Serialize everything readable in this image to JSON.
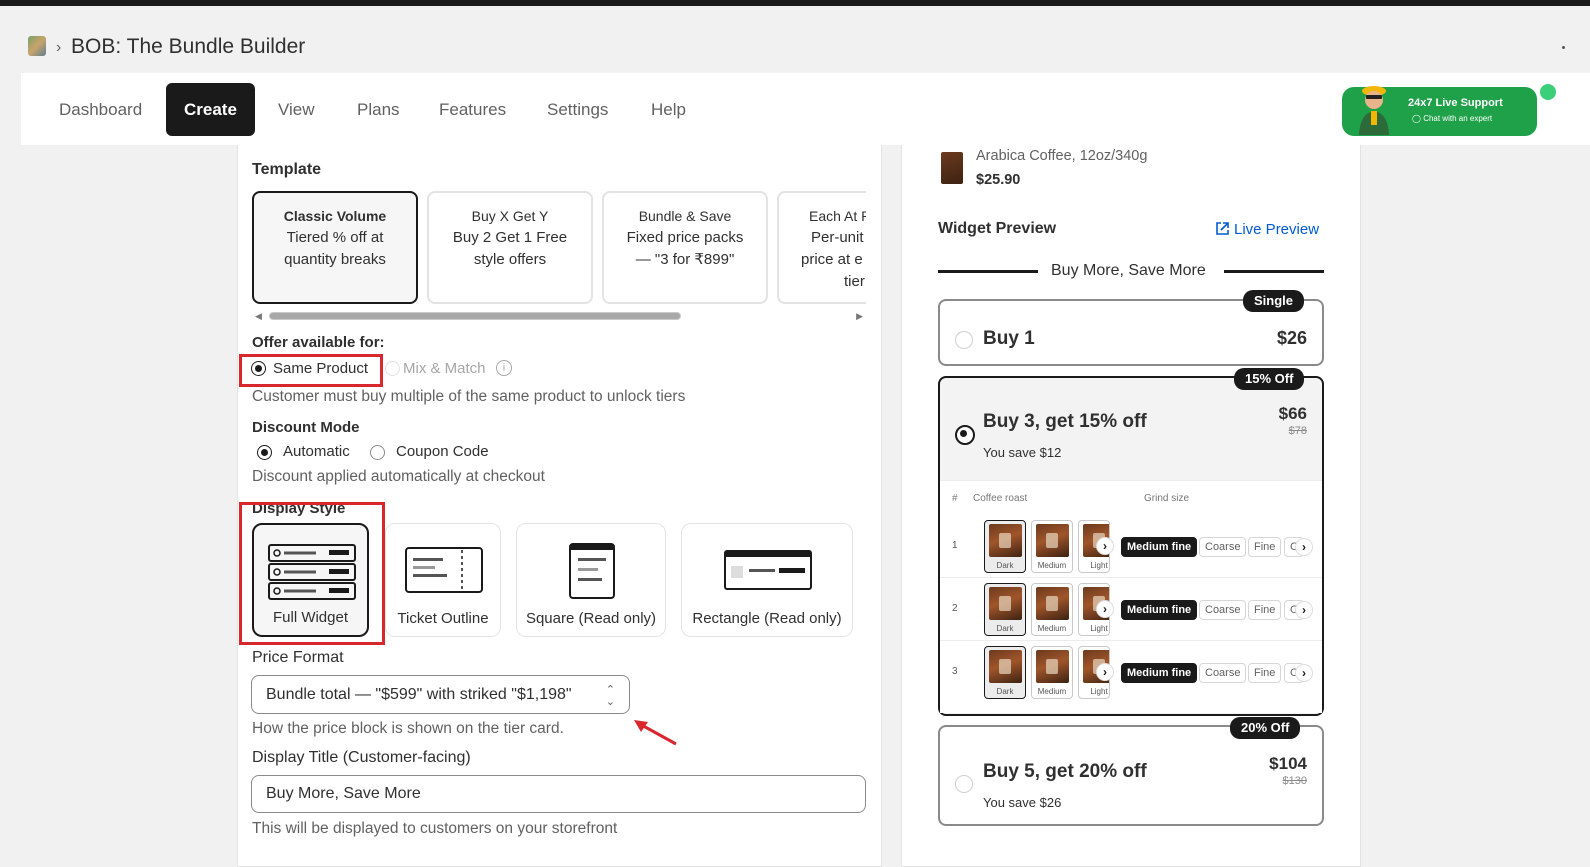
{
  "app": {
    "title": "BOB: The Bundle Builder",
    "breadcrumb_sep": "›"
  },
  "nav": {
    "items": [
      "Dashboard",
      "Create",
      "View",
      "Plans",
      "Features",
      "Settings",
      "Help"
    ],
    "active": "Create"
  },
  "support": {
    "title": "24x7 Live Support",
    "subtitle": "Chat with an expert"
  },
  "template": {
    "label": "Template",
    "cards": [
      {
        "title": "Classic Volume",
        "line1": "Tiered % off at",
        "line2": "quantity breaks",
        "selected": true
      },
      {
        "title": "Buy X Get Y",
        "line1": "Buy 2 Get 1 Free",
        "line2": "style offers",
        "selected": false
      },
      {
        "title": "Bundle & Save",
        "line1": "Fixed price packs",
        "line2": "— \"3 for ₹899\"",
        "selected": false
      },
      {
        "title": "Each At P",
        "line1": "Per-unit",
        "line2": "price at e",
        "line3": "tier",
        "selected": false
      }
    ]
  },
  "offer": {
    "label": "Offer available for:",
    "options": [
      "Same Product",
      "Mix & Match"
    ],
    "selected": "Same Product",
    "help": "Customer must buy multiple of the same product to unlock tiers"
  },
  "discount": {
    "label": "Discount Mode",
    "options": [
      "Automatic",
      "Coupon Code"
    ],
    "selected": "Automatic",
    "help": "Discount applied automatically at checkout"
  },
  "display_style": {
    "label": "Display Style",
    "options": [
      "Full Widget",
      "Ticket Outline",
      "Square (Read only)",
      "Rectangle (Read only)"
    ],
    "selected": "Full Widget"
  },
  "price_format": {
    "label": "Price Format",
    "value": "Bundle total — \"$599\" with striked \"$1,198\"",
    "help": "How the price block is shown on the tier card."
  },
  "display_title": {
    "label": "Display Title (Customer-facing)",
    "value": "Buy More, Save More",
    "help": "This will be displayed to customers on your storefront"
  },
  "preview": {
    "product_name": "Arabica Coffee, 12oz/340g",
    "product_price": "$25.90",
    "widget_preview_label": "Widget Preview",
    "live_preview_label": "Live Preview",
    "heading": "Buy More, Save More",
    "tiers": [
      {
        "badge": "Single",
        "title": "Buy 1",
        "price": "$26",
        "selected": false
      },
      {
        "badge": "15% Off",
        "title": "Buy 3, get 15% off",
        "price": "$66",
        "compare": "$78",
        "savings": "You save $12",
        "selected": true
      },
      {
        "badge": "20% Off",
        "title": "Buy 5, get 20% off",
        "price": "$104",
        "compare": "$130",
        "savings": "You save $26",
        "selected": false
      }
    ],
    "variant_table": {
      "col_hash": "#",
      "col_roast": "Coffee roast",
      "col_grind": "Grind size",
      "roasts": [
        "Dark",
        "Medium",
        "Light"
      ],
      "grinds": [
        "Medium fine",
        "Coarse",
        "Fine",
        "C"
      ],
      "rows": [
        {
          "index": "1",
          "roast": "Dark",
          "grind": "Medium fine"
        },
        {
          "index": "2",
          "roast": "Dark",
          "grind": "Medium fine"
        },
        {
          "index": "3",
          "roast": "Dark",
          "grind": "Medium fine"
        }
      ]
    }
  },
  "colors": {
    "accent": "#1a1a1a",
    "highlight_red": "#d9272e",
    "support_green": "#1fa149",
    "link_blue": "#005bd3"
  }
}
